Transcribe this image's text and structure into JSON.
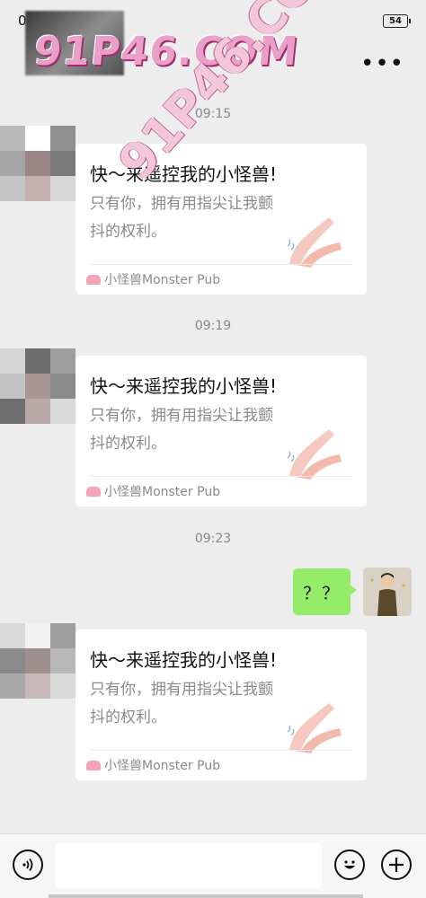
{
  "status": {
    "time": "09:37",
    "battery": "54"
  },
  "header": {
    "more_icon": "more-dots-icon"
  },
  "watermark": {
    "logo": "91P46.COM",
    "diagonal": "91P46.COM"
  },
  "messages": [
    {
      "time": "09:15",
      "title": "快～来遥控我的小怪兽!",
      "desc": "只有你，拥有用指尖让我颤抖的权利。",
      "source": "小怪兽Monster Pub"
    },
    {
      "time": "09:19",
      "title": "快～来遥控我的小怪兽!",
      "desc": "只有你，拥有用指尖让我颤抖的权利。",
      "source": "小怪兽Monster Pub"
    },
    {
      "time": "09:23",
      "title": "快～来遥控我的小怪兽!",
      "desc": "只有你，拥有用指尖让我颤抖的权利。",
      "source": "小怪兽Monster Pub"
    }
  ],
  "my_message": {
    "text": "？？"
  },
  "input": {
    "placeholder": "",
    "voice_icon": "voice-icon",
    "emoji_icon": "emoji-icon",
    "plus_icon": "plus-icon"
  },
  "colors": {
    "background": "#ededed",
    "my_bubble": "#95ec69",
    "card": "#ffffff",
    "source_icon": "#f2a4b6"
  }
}
